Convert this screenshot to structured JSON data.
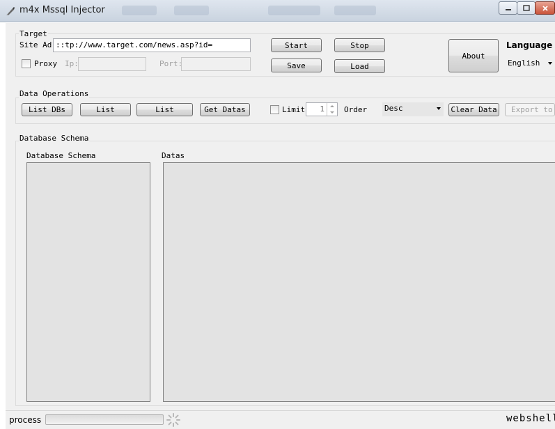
{
  "window": {
    "title": "m4x Mssql Injector",
    "icon": "app-icon"
  },
  "target": {
    "legend": "Target",
    "site_label": "Site Adı",
    "site_value": "::tp://www.target.com/news.asp?id=",
    "proxy_label": "Proxy",
    "ip_label": "Ip:",
    "ip_value": "",
    "port_label": "Port:",
    "port_value": "",
    "start": "Start",
    "stop": "Stop",
    "save": "Save",
    "load": "Load",
    "about": "About",
    "language_label": "Language",
    "language_value": "English"
  },
  "data_ops": {
    "legend": "Data Operations",
    "list_dbs": "List DBs",
    "list1": "List",
    "list2": "List",
    "get_datas": "Get Datas",
    "limit_label": "Limit",
    "limit_value": "1",
    "order_label": "Order",
    "order_value": "Desc",
    "clear_data": "Clear Data",
    "export": "Export to"
  },
  "schema": {
    "legend": "Database Schema",
    "left_label": "Database Schema",
    "right_label": "Datas"
  },
  "status": {
    "process_label": "process",
    "progress": 0,
    "brand": "webshell"
  },
  "colors": {
    "window_bg": "#f0f0f0",
    "panel_bg": "#e3e3e3",
    "titlebar": "#d3dbe6"
  }
}
